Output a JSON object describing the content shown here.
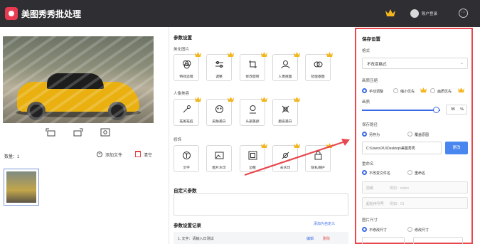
{
  "app": {
    "title": "美图秀秀批处理",
    "login_label": "账户登录"
  },
  "left": {
    "count_label": "数量：1",
    "add_file_label": "添加文件",
    "clear_label": "清空"
  },
  "params": {
    "title": "参数设置",
    "groups": [
      {
        "label": "美化图片",
        "tools": [
          {
            "label": "特效滤镜",
            "icon": "filter-icon",
            "vip": true
          },
          {
            "label": "调整",
            "icon": "adjust-icon",
            "vip": true
          },
          {
            "label": "修改旋转",
            "icon": "crop-rotate-icon",
            "vip": true
          },
          {
            "label": "人像抠图",
            "icon": "portrait-cutout-icon",
            "vip": true
          },
          {
            "label": "智能抠图",
            "icon": "smart-cutout-icon",
            "vip": true
          }
        ]
      },
      {
        "label": "人像美容",
        "tools": [
          {
            "label": "祛斑祛痘",
            "icon": "acne-remove-icon",
            "vip": true
          },
          {
            "label": "皮肤美白",
            "icon": "skin-whiten-icon",
            "vip": true
          },
          {
            "label": "头部美颜",
            "icon": "head-beauty-icon",
            "vip": true
          },
          {
            "label": "磨皮美白",
            "icon": "smooth-skin-icon",
            "vip": true
          }
        ]
      },
      {
        "label": "修饰",
        "tools": [
          {
            "label": "文字",
            "icon": "text-icon",
            "vip": false
          },
          {
            "label": "图片水印",
            "icon": "image-watermark-icon",
            "vip": false
          },
          {
            "label": "边框",
            "icon": "border-icon",
            "vip": true
          },
          {
            "label": "去水印",
            "icon": "remove-watermark-icon",
            "vip": true
          },
          {
            "label": "隐私保护",
            "icon": "privacy-icon",
            "vip": true
          }
        ]
      }
    ],
    "custom_title": "自定义参数",
    "record_title": "参数设置记录",
    "add_record_label": "添加为自定义",
    "record": {
      "text": "1. 文字：请输入日测试",
      "edit": "编辑",
      "delete": "删除"
    }
  },
  "save": {
    "title": "保存设置",
    "format_label": "格式",
    "format_value": "不改变格式",
    "compress_label": "画质压缩",
    "compress_options": [
      "手动调整",
      "缩小优先",
      "画质优先"
    ],
    "compress_selected": 0,
    "quality_label": "画质",
    "quality_value": "95",
    "quality_unit": "%",
    "quality_fraction": 0.95,
    "path_label": "保存路径",
    "path_options": [
      "另存为",
      "覆盖原图"
    ],
    "path_selected": 0,
    "path_value": "C:\\Users\\XU\\Desktop\\美图秀秀",
    "change_label": "更改",
    "rename_label": "重命名",
    "rename_options": [
      "不改变文件名",
      "重命名"
    ],
    "rename_selected": 0,
    "prefix_label": "前缀",
    "prefix_placeholder": "例如：index",
    "start_label": "起始序列号",
    "start_placeholder": "例如：01",
    "size_label": "图片尺寸",
    "size_options": [
      "不修改尺寸",
      "修改尺寸"
    ],
    "size_selected": 0
  },
  "colors": {
    "accent": "#3a6ae8",
    "highlight_border": "#e8474d",
    "crown": "#f3b61f",
    "titlebar": "#2f2f33"
  }
}
